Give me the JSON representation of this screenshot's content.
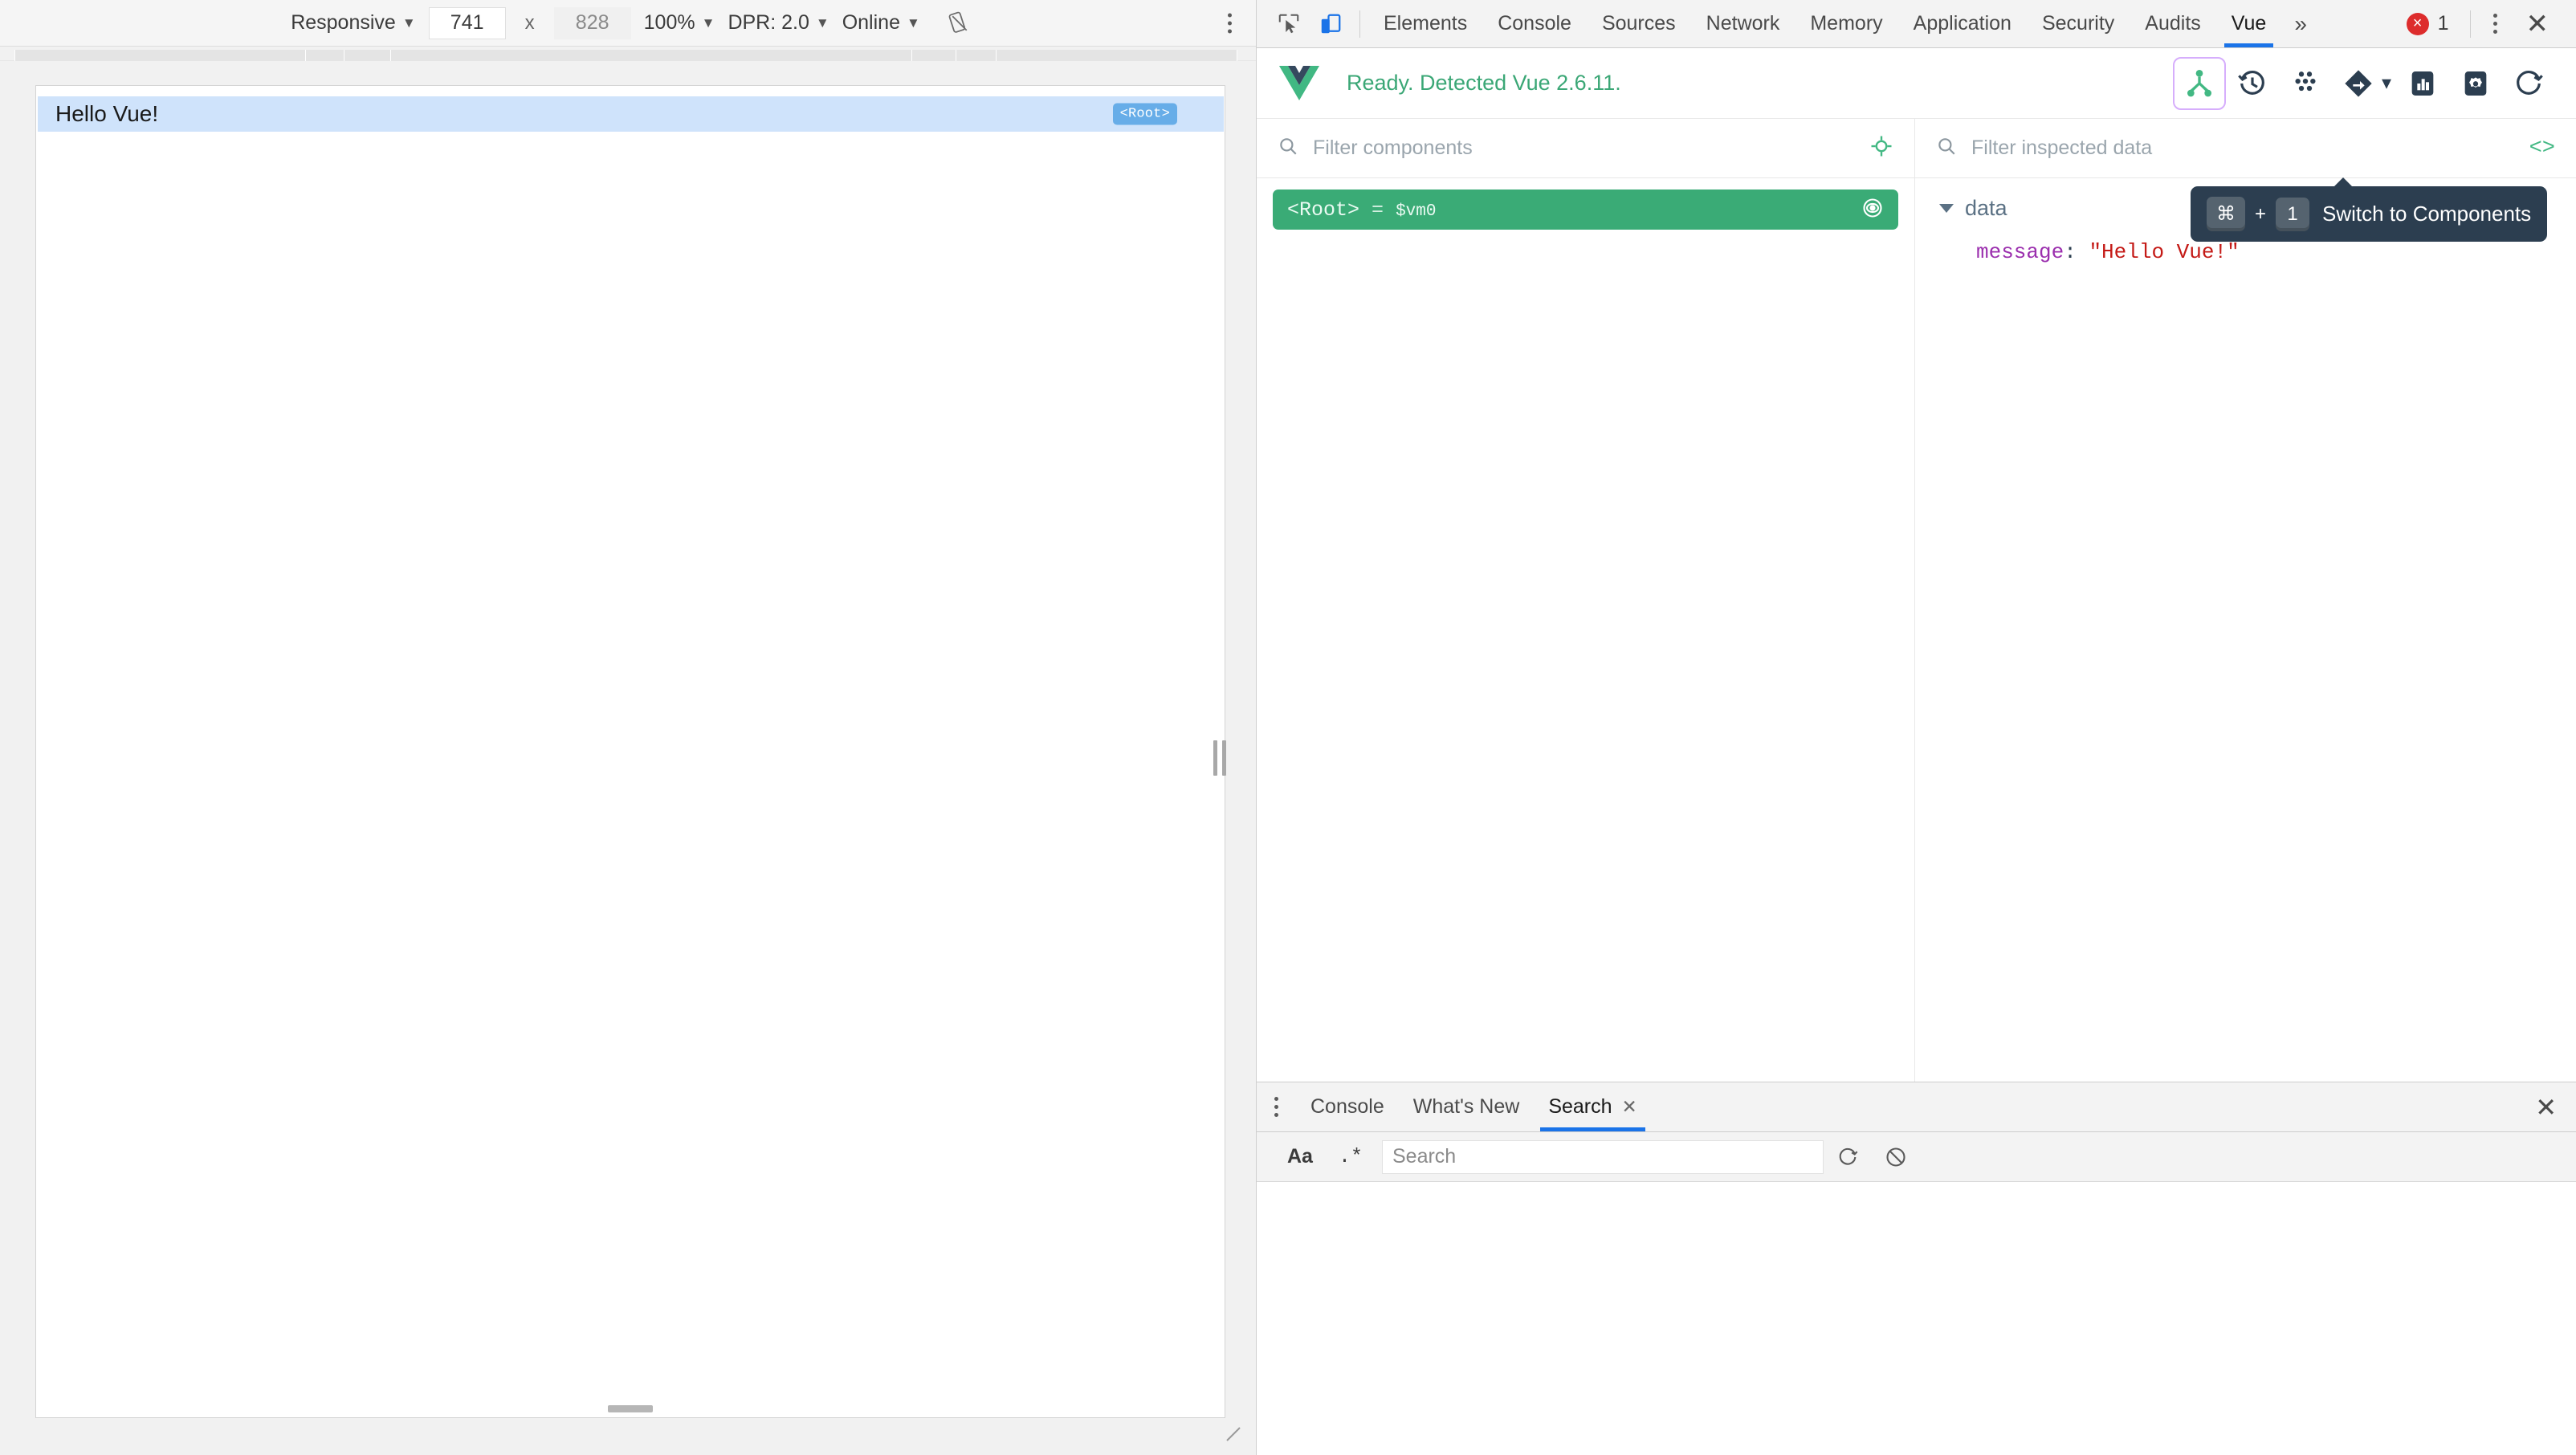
{
  "device_toolbar": {
    "device_preset": "Responsive",
    "width": "741",
    "x_separator": "x",
    "height": "828",
    "zoom": "100%",
    "dpr": "DPR: 2.0",
    "throttling": "Online",
    "rotate_icon": "rotate-device-icon",
    "more_icon": "more-options-icon"
  },
  "page": {
    "heading": "Hello Vue!",
    "component_badge": "<Root>"
  },
  "devtools_tabs": {
    "inspect_icon": "inspect-element-icon",
    "device_icon": "toggle-device-toolbar-icon",
    "items": [
      {
        "label": "Elements",
        "active": false
      },
      {
        "label": "Console",
        "active": false
      },
      {
        "label": "Sources",
        "active": false
      },
      {
        "label": "Network",
        "active": false
      },
      {
        "label": "Memory",
        "active": false
      },
      {
        "label": "Application",
        "active": false
      },
      {
        "label": "Security",
        "active": false
      },
      {
        "label": "Audits",
        "active": false
      },
      {
        "label": "Vue",
        "active": true
      }
    ],
    "overflow_label": "»",
    "error_count": "1",
    "error_glyph": "×",
    "close_glyph": "✕"
  },
  "vue_panel": {
    "logo": "vue-logo-icon",
    "status": "Ready. Detected Vue 2.6.11.",
    "actions": [
      {
        "name": "components-tab-icon",
        "selected": true
      },
      {
        "name": "timeline-tab-icon",
        "selected": false
      },
      {
        "name": "vuex-tab-icon",
        "selected": false
      },
      {
        "name": "routing-tab-icon",
        "selected": false
      },
      {
        "name": "performance-tab-icon",
        "selected": false
      },
      {
        "name": "settings-icon",
        "selected": false
      },
      {
        "name": "refresh-icon",
        "selected": false
      }
    ],
    "filter_components_placeholder": "Filter components",
    "select_component_icon": "target-crosshair-icon",
    "filter_inspected_placeholder": "Filter inspected data",
    "code_toggle": "<>",
    "tooltip": {
      "key_modifier": "⌘",
      "plus": "+",
      "key_number": "1",
      "text": "Switch to Components"
    }
  },
  "component_tree": {
    "rows": [
      {
        "tag": "<Root>",
        "eq": "=",
        "vm": "$vm0",
        "selected": true,
        "eye_icon": "eye-icon"
      }
    ]
  },
  "inspector": {
    "groups": [
      {
        "name": "data",
        "expanded": true,
        "entries": [
          {
            "key": "message",
            "colon": ":",
            "value": "\"Hello Vue!\""
          }
        ]
      }
    ]
  },
  "drawer": {
    "kebab_icon": "drawer-more-icon",
    "tabs": [
      {
        "label": "Console",
        "active": false,
        "closable": false
      },
      {
        "label": "What's New",
        "active": false,
        "closable": false
      },
      {
        "label": "Search",
        "active": true,
        "closable": true,
        "close_glyph": "✕"
      }
    ],
    "close_glyph": "✕",
    "search": {
      "match_case_label": "Aa",
      "regex_label": ".*",
      "placeholder": "Search",
      "refresh_icon": "refresh-icon",
      "clear_icon": "clear-icon"
    }
  },
  "colors": {
    "vue_green": "#42b883",
    "tree_selected": "#3aab76",
    "accent_blue": "#1a73e8",
    "tooltip_bg": "#2c3e50",
    "highlight_blue": "#cfe3fb",
    "badge_blue": "#67ade8",
    "error_red": "#dd2c2c",
    "string_red": "#c41a16",
    "key_purple": "#9b2fae",
    "selected_outline": "#d6aefc"
  }
}
